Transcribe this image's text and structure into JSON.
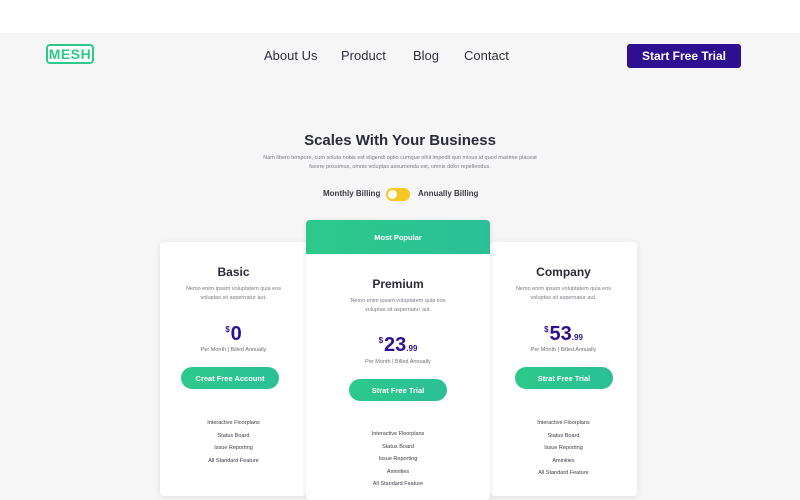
{
  "brand": {
    "logo_text": "MESH"
  },
  "nav": {
    "items": [
      "About Us",
      "Product",
      "Blog",
      "Contact"
    ],
    "cta_label": "Start Free Trial"
  },
  "section": {
    "title": "Scales With Your Business",
    "subtitle": "Nam libero tempore, cum soluta nobis est eligendi optio cumque nihil impedit quo minus id quod maxime placeat facere possimus, omnis voluptas assumenda est, omnis dolor repellendus."
  },
  "billing": {
    "monthly_label": "Monthly Billing",
    "annual_label": "Annually Billing",
    "toggle_color": "#f6c624"
  },
  "plans": [
    {
      "name": "Basic",
      "description": "Nemo enim ipsam voluptatem quia eos voluptas sit aspernatur aut.",
      "currency": "$",
      "amount": "0",
      "cents": "",
      "period": "Per Month | Billed Annually",
      "button_label": "Creat Free Account",
      "features": [
        "Interactive Floorplans",
        "Status Board",
        "Issue Reporting",
        "All Standard Feature"
      ]
    },
    {
      "badge": "Most Popular",
      "name": "Premium",
      "description": "Nemo enim ipsam voluptatem quia eos voluptas sit aspernatur aut.",
      "currency": "$",
      "amount": "23",
      "cents": ".99",
      "period": "Per Month | Billed Annually",
      "button_label": "Strat Free Trial",
      "features": [
        "Interactive Floorplans",
        "Status Board",
        "Issue Reporting",
        "Aminities",
        "All Standard Feature"
      ]
    },
    {
      "name": "Company",
      "description": "Nemo enim ipsam voluptatem quia eos voluptas sit aspernatur aut.",
      "currency": "$",
      "amount": "53",
      "cents": ".99",
      "period": "Per Month | Billed Annually",
      "button_label": "Strat Free Trial",
      "features": [
        "Interactive Floorplans",
        "Status Board",
        "Issue Reporting",
        "Aminities",
        "All Standard Feature"
      ]
    }
  ],
  "colors": {
    "accent_green": "#2dc98a",
    "brand_purple": "#2d0f8f",
    "background": "#f6f6f7"
  }
}
